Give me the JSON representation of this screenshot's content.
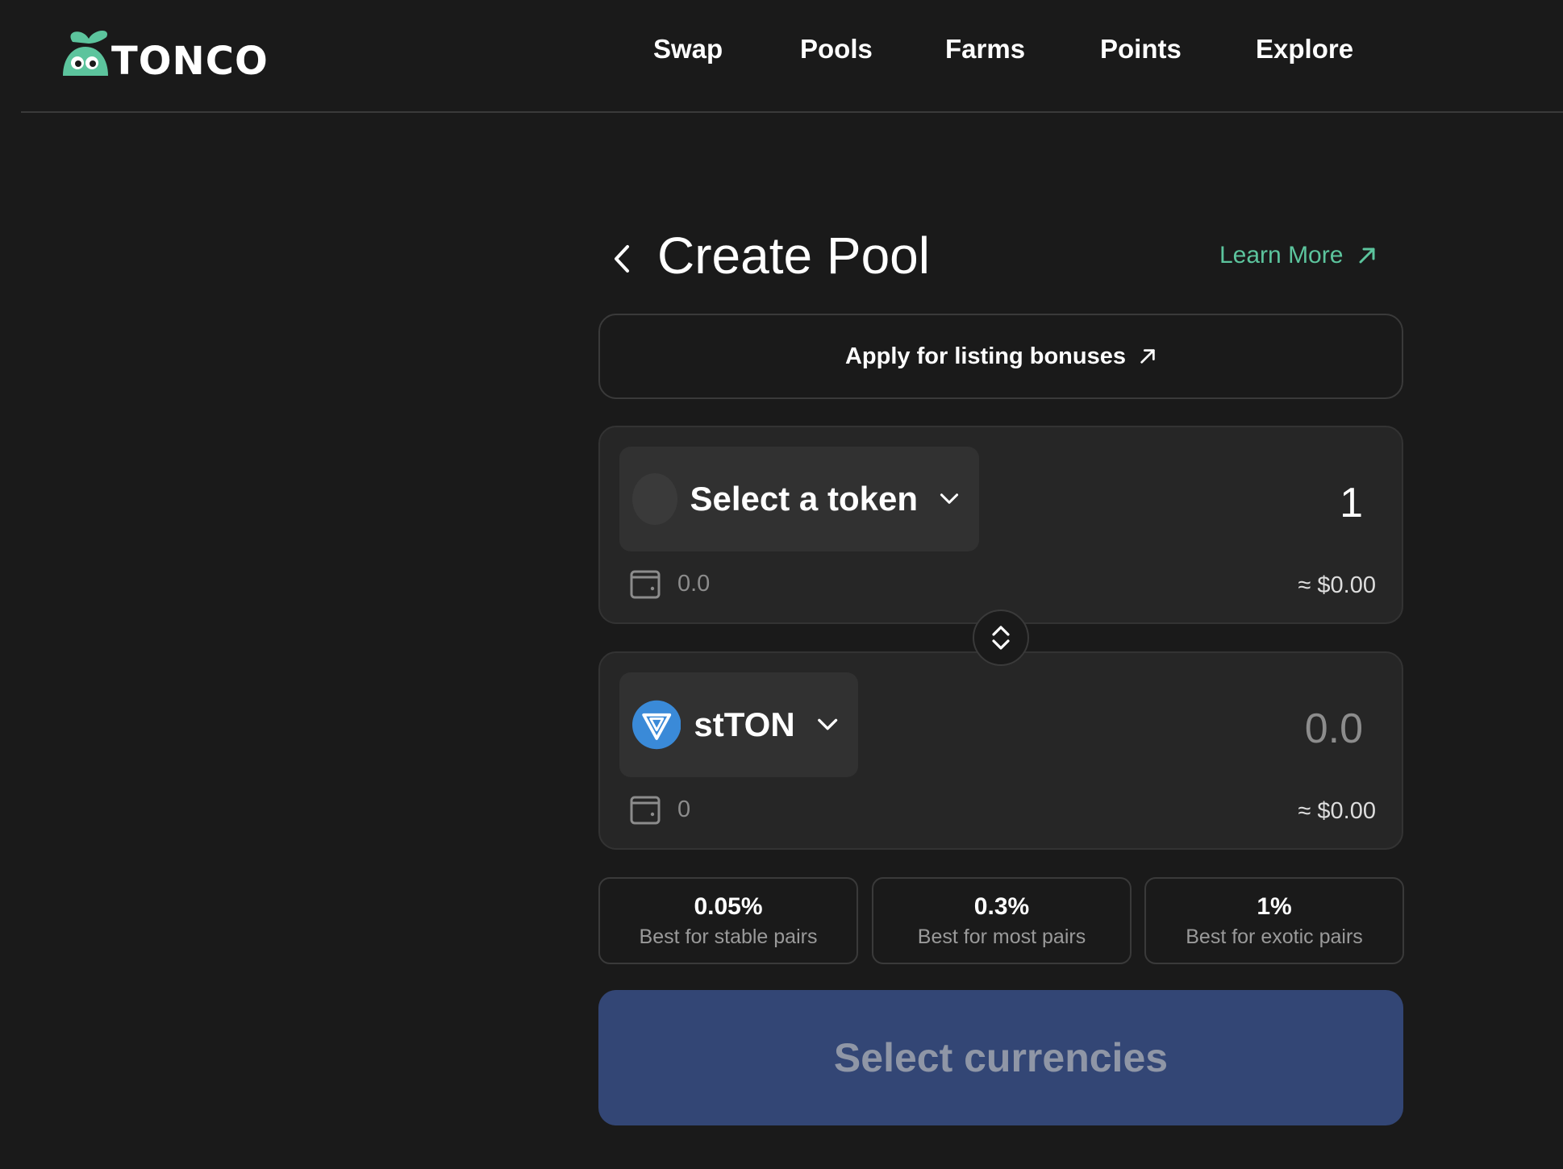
{
  "app": {
    "logo_text": "TONCO",
    "brand_color": "#5cc49d"
  },
  "nav": {
    "items": [
      {
        "label": "Swap"
      },
      {
        "label": "Pools"
      },
      {
        "label": "Farms"
      },
      {
        "label": "Points"
      },
      {
        "label": "Explore"
      }
    ]
  },
  "page": {
    "title": "Create Pool",
    "learn_more_label": "Learn More",
    "bonus_label": "Apply for listing bonuses"
  },
  "token_a": {
    "label": "Select a token",
    "amount": "1",
    "balance": "0.0",
    "usd": "≈ $0.00"
  },
  "token_b": {
    "label": "stTON",
    "icon": "stton-logo-icon",
    "amount": "0.0",
    "balance": "0",
    "usd": "≈ $0.00"
  },
  "fees": [
    {
      "value": "0.05%",
      "desc": "Best for stable pairs"
    },
    {
      "value": "0.3%",
      "desc": "Best for most pairs"
    },
    {
      "value": "1%",
      "desc": "Best for exotic pairs"
    }
  ],
  "action": {
    "label": "Select currencies",
    "color": "#334675"
  }
}
